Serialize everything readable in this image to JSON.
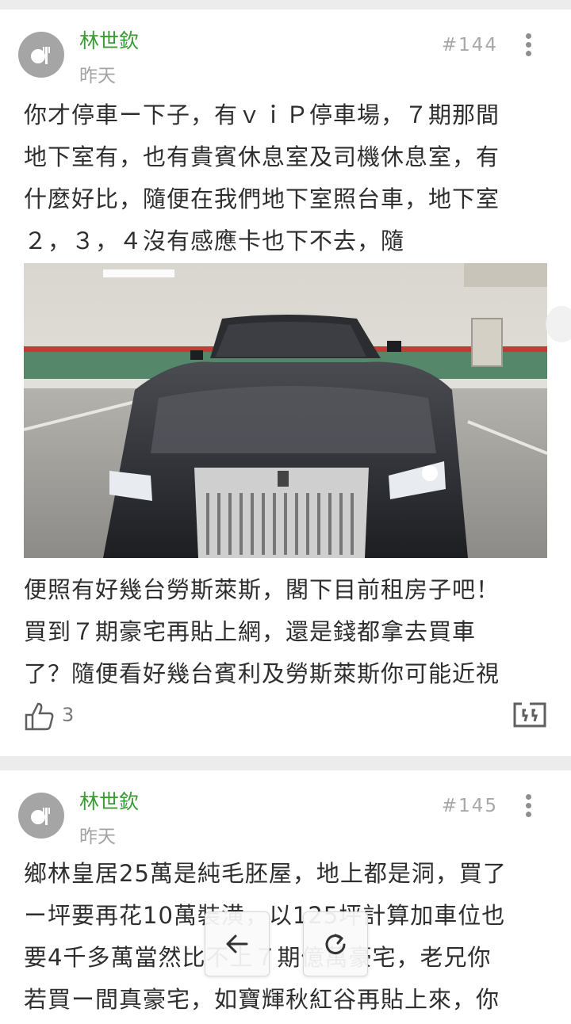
{
  "posts": [
    {
      "author": "林世欽",
      "date": "昨天",
      "floor": "#144",
      "text_before": "你才停車ー下子，有ｖｉＰ停車場，７期那間\n地下室有，也有貴賓休息室及司機休息室，有\n什麼好比，隨便在我們地下室照台車，地下室\n２，３，４沒有感應卡也下不去，隨",
      "image_icon": "rolls-royce-photo",
      "text_after": "便照有好幾台勞斯萊斯，閣下目前租房子吧！\n買到７期豪宅再貼上網，還是錢都拿去買車\n了？隨便看好幾台賓利及勞斯萊斯你可能近視",
      "likes": "3"
    },
    {
      "author": "林世欽",
      "date": "昨天",
      "floor": "#145",
      "text_before": "鄉林皇居25萬是純毛胚屋，地上都是洞，買了\nー坪要再花10萬裝潢，以125坪計算加車位也\n要4千多萬當然比不上７期億萬豪宅，老兄你\n若買ー間真豪宅，如寶輝秋紅谷再貼上來，你"
    }
  ],
  "nav": {
    "back_icon": "arrow-left-icon",
    "refresh_icon": "refresh-icon"
  },
  "colors": {
    "author": "#3a9a35",
    "background": "#ececec",
    "text": "#2e2e2e"
  }
}
